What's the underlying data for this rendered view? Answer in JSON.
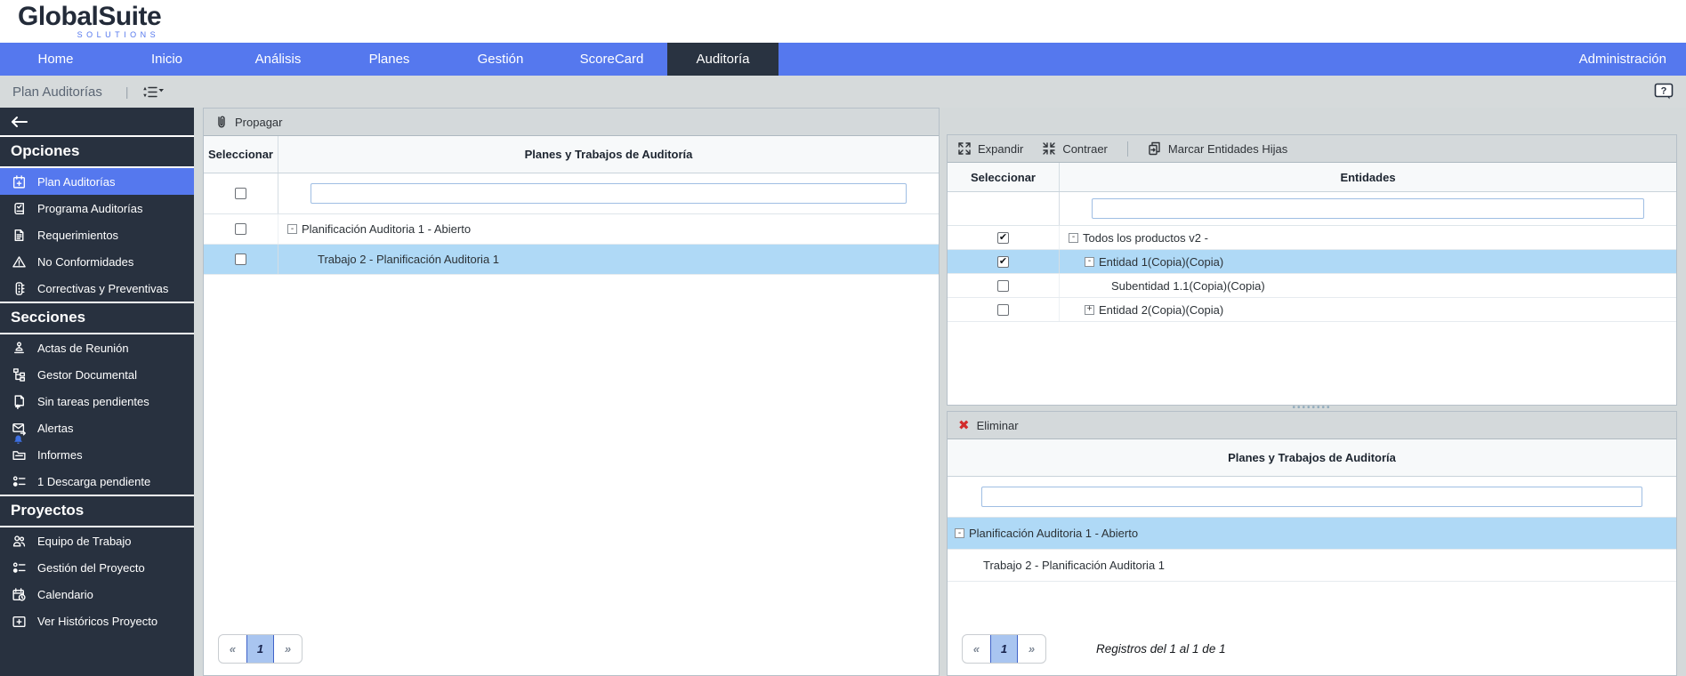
{
  "brand": {
    "name": "GlobalSuite",
    "tagline": "SOLUTIONS"
  },
  "nav": {
    "items": [
      "Home",
      "Inicio",
      "Análisis",
      "Planes",
      "Gestión",
      "ScoreCard",
      "Auditoría"
    ],
    "active": "Auditoría",
    "admin": "Administración"
  },
  "breadcrumb": {
    "title": "Plan Auditorías"
  },
  "help": {
    "glyph": "?"
  },
  "sidebar": {
    "sections": [
      {
        "heading": "Opciones",
        "items": [
          {
            "icon": "calendar-plus-icon",
            "label": "Plan Auditorías",
            "selected": true
          },
          {
            "icon": "book-check-icon",
            "label": "Programa Auditorías",
            "selected": false
          },
          {
            "icon": "document-icon",
            "label": "Requerimientos",
            "selected": false
          },
          {
            "icon": "warning-icon",
            "label": "No Conformidades",
            "selected": false
          },
          {
            "icon": "traffic-light-icon",
            "label": "Correctivas y Preventivas",
            "selected": false
          }
        ]
      },
      {
        "heading": "Secciones",
        "items": [
          {
            "icon": "stamp-icon",
            "label": "Actas de Reunión",
            "selected": false
          },
          {
            "icon": "org-tree-icon",
            "label": "Gestor Documental",
            "selected": false
          },
          {
            "icon": "file-plus-icon",
            "label": "Sin tareas pendientes",
            "selected": false
          },
          {
            "icon": "mail-forward-icon",
            "label": "Alertas",
            "selected": false,
            "badge": "bell"
          },
          {
            "icon": "folder-icon",
            "label": "Informes",
            "selected": false
          },
          {
            "icon": "task-list-icon",
            "label": "1 Descarga pendiente",
            "selected": false
          }
        ]
      },
      {
        "heading": "Proyectos",
        "items": [
          {
            "icon": "team-icon",
            "label": "Equipo de Trabajo",
            "selected": false
          },
          {
            "icon": "task-list-icon",
            "label": "Gestión del Proyecto",
            "selected": false
          },
          {
            "icon": "calendar-clock-icon",
            "label": "Calendario",
            "selected": false
          },
          {
            "icon": "folder-plus-icon",
            "label": "Ver Históricos Proyecto",
            "selected": false
          }
        ]
      }
    ]
  },
  "plans_panel": {
    "toolbar": {
      "propagate": "Propagar"
    },
    "columns": {
      "select": "Seleccionar",
      "main": "Planes y Trabajos de Auditoría"
    },
    "filter_value": "",
    "rows": [
      {
        "label": "Planificación Auditoria 1 - Abierto",
        "expander": "-",
        "level": 0,
        "checked": false,
        "highlighted": false
      },
      {
        "label": "Trabajo 2 - Planificación Auditoria 1",
        "expander": "",
        "level": 1,
        "checked": false,
        "highlighted": true
      }
    ],
    "pager": {
      "prev": "«",
      "page": "1",
      "next": "»"
    }
  },
  "entities_panel": {
    "toolbar": {
      "expand": "Expandir",
      "collapse": "Contraer",
      "mark_children": "Marcar Entidades Hijas"
    },
    "columns": {
      "select": "Seleccionar",
      "main": "Entidades"
    },
    "filter_value": "",
    "rows": [
      {
        "label": "Todos los productos v2 -",
        "expander": "-",
        "level": 0,
        "checked": true,
        "highlighted": false
      },
      {
        "label": "Entidad 1(Copia)(Copia)",
        "expander": "-",
        "level": 1,
        "checked": true,
        "highlighted": true
      },
      {
        "label": "Subentidad 1.1(Copia)(Copia)",
        "expander": "",
        "level": 2,
        "checked": false,
        "highlighted": false
      },
      {
        "label": "Entidad 2(Copia)(Copia)",
        "expander": "+",
        "level": 1,
        "checked": false,
        "highlighted": false
      }
    ]
  },
  "delete_panel": {
    "toolbar": {
      "delete": "Eliminar"
    },
    "columns": {
      "main": "Planes y Trabajos de Auditoría"
    },
    "filter_value": "",
    "rows": [
      {
        "label": "Planificación Auditoria 1 - Abierto",
        "expander": "-",
        "level": 0,
        "highlighted": true
      },
      {
        "label": "Trabajo 2 - Planificación Auditoria 1",
        "expander": "",
        "level": 1,
        "highlighted": false
      }
    ],
    "pager": {
      "prev": "«",
      "page": "1",
      "next": "»"
    },
    "records_text": "Registros del 1 al 1 de 1"
  },
  "colors": {
    "accent": "#5578EE",
    "dark": "#28313F",
    "row_highlight": "#AFD9F6",
    "danger": "#D22B2B"
  }
}
